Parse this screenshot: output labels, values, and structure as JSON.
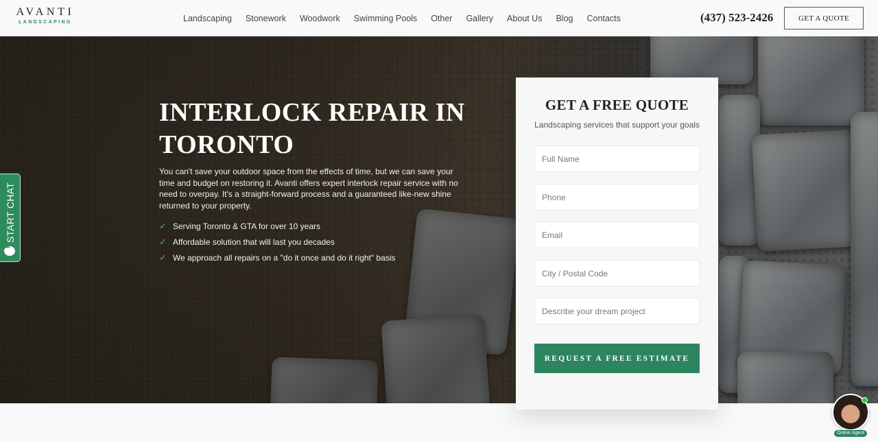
{
  "header": {
    "logo_main": "AVANTI",
    "logo_sub": "LANDSCAPING",
    "nav": [
      {
        "label": "Landscaping"
      },
      {
        "label": "Stonework"
      },
      {
        "label": "Woodwork"
      },
      {
        "label": "Swimming Pools"
      },
      {
        "label": "Other"
      },
      {
        "label": "Gallery"
      },
      {
        "label": "About Us"
      },
      {
        "label": "Blog"
      },
      {
        "label": "Contacts"
      }
    ],
    "phone": "(437) 523-2426",
    "quote_button": "GET A QUOTE"
  },
  "hero": {
    "title": "INTERLOCK REPAIR IN TORONTO",
    "description": "You can't save your outdoor space from the effects of time, but we can save your time and budget on restoring it. Avanti offers expert interlock repair service with no need to overpay. It's a straight-forward process and a guaranteed like-new shine returned to your property.",
    "bullets": [
      {
        "icon": "check-icon",
        "text": "Serving Toronto & GTA for over 10 years"
      },
      {
        "icon": "check-icon",
        "text": "Affordable solution that will last you decades"
      },
      {
        "icon": "check-icon",
        "text": "We approach all repairs on a \"do it once and do it right\" basis"
      }
    ]
  },
  "chat_tab": {
    "label": "START CHAT",
    "icon": "chat-bubble-icon"
  },
  "form": {
    "title": "GET A FREE QUOTE",
    "subtitle": "Landscaping services that support your goals",
    "fields": [
      {
        "name": "full-name",
        "placeholder": "Full Name",
        "value": ""
      },
      {
        "name": "phone",
        "placeholder": "Phone",
        "value": ""
      },
      {
        "name": "email",
        "placeholder": "Email",
        "value": ""
      },
      {
        "name": "city-postal",
        "placeholder": "City / Postal Code",
        "value": ""
      },
      {
        "name": "project-description",
        "placeholder": "Describe your dream project",
        "value": ""
      }
    ],
    "submit_label": "REQUEST A FREE ESTIMATE"
  },
  "agent_widget": {
    "label": "Online Agent",
    "status": "online"
  },
  "colors": {
    "brand_green": "#2d8560",
    "online_green": "#2ecc40"
  }
}
